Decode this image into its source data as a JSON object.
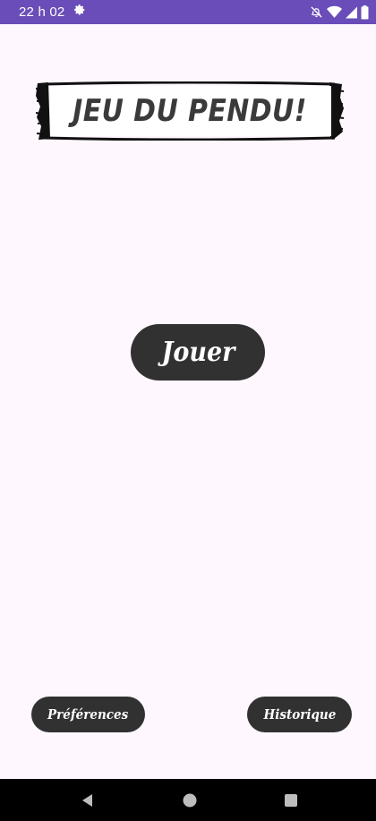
{
  "status_bar": {
    "time": "22 h 02",
    "icons": [
      "settings-icon",
      "notifications-off-icon",
      "wifi-icon",
      "signal-icon",
      "battery-icon"
    ]
  },
  "app": {
    "title": "JEU DU PENDU!",
    "play_label": "Jouer",
    "preferences_label": "Préférences",
    "history_label": "Historique"
  },
  "nav_bar": {
    "icons": [
      "back-icon",
      "home-icon",
      "recents-icon"
    ]
  },
  "colors": {
    "status_bar": "#6A4DB8",
    "background": "#FEF7FE",
    "button": "#323132",
    "button_text": "#FFFFFF",
    "nav_bar": "#000000"
  }
}
